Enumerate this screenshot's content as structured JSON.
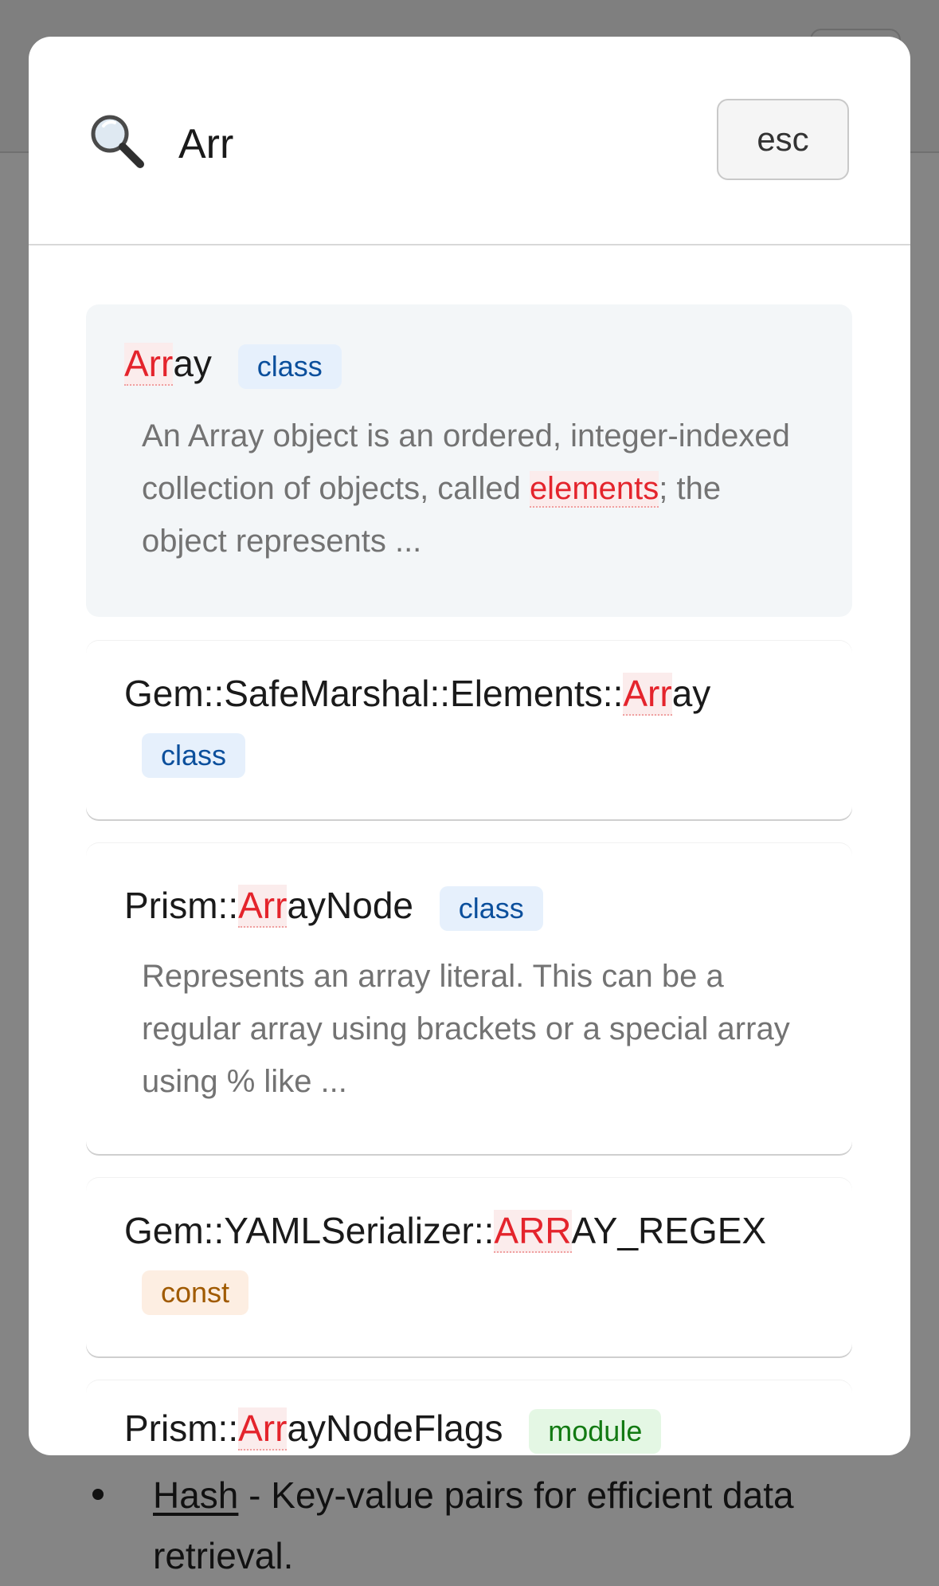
{
  "search": {
    "query": "Arr",
    "esc_label": "esc"
  },
  "results": [
    {
      "title_pre": "",
      "title_match": "Arr",
      "title_post": "ay",
      "kind": "class",
      "desc_pre": "An Array object is an ordered, integer-indexed collection of objects, called ",
      "desc_match": "elements",
      "desc_post": "; the object represents ..."
    },
    {
      "title_pre": "Gem::SafeMarshal::Elements::",
      "title_match": "Arr",
      "title_post": "ay",
      "kind": "class"
    },
    {
      "title_pre": "Prism::",
      "title_match": "Arr",
      "title_post": "ayNode",
      "kind": "class",
      "desc": "Represents an array literal. This can be a regular array using brackets or a special array using % like ..."
    },
    {
      "title_pre": "Gem::YAMLSerializer::",
      "title_match": "ARR",
      "title_post": "AY_REGEX",
      "kind": "const"
    },
    {
      "title_pre": "Prism::",
      "title_match": "Arr",
      "title_post": "ayNodeFlags",
      "kind": "module"
    }
  ],
  "background": {
    "list_item_link": "Hash",
    "list_item_text": " - Key-value pairs for efficient data retrieval."
  },
  "colors": {
    "highlight": "#e4242c",
    "class_badge": "#0b4f9c",
    "const_badge": "#a05a00",
    "module_badge": "#127a12"
  }
}
